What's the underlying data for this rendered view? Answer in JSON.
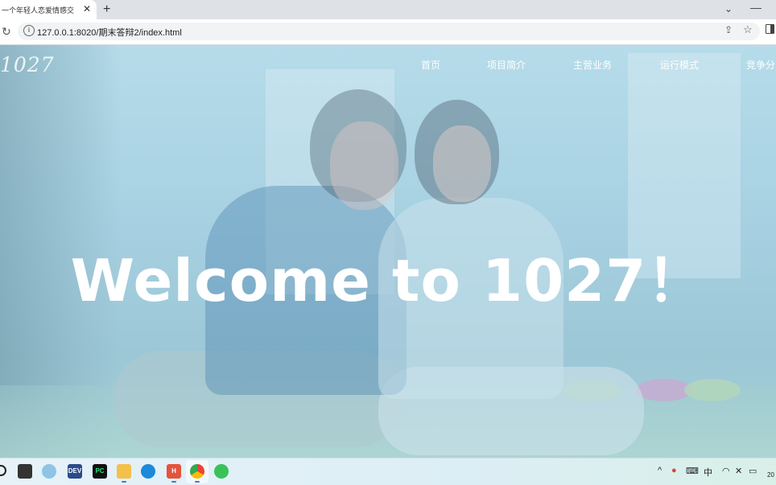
{
  "browser": {
    "tab_title": "一个年轻人恋爱情感交",
    "tab_close": "✕",
    "new_tab": "+",
    "tab_menu": "⌄",
    "minimize": "—",
    "url": "127.0.0.1:8020/期末答辩2/index.html"
  },
  "site": {
    "logo": "1027",
    "nav": [
      "首页",
      "项目简介",
      "主营业务",
      "运行模式",
      "竞争分"
    ],
    "headline": "Welcome to 1027！"
  },
  "taskbar": {
    "apps": [
      "search-icon",
      "task-view-icon",
      "app-icon",
      "dev-icon",
      "pycharm-icon",
      "file-explorer-icon",
      "edge-icon",
      "hbuilder-icon",
      "chrome-icon",
      "wechat-icon"
    ],
    "dev_label": "DEV",
    "pycharm_label": "PC",
    "hbuilder_label": "H",
    "ime": "中",
    "clock": "20"
  }
}
